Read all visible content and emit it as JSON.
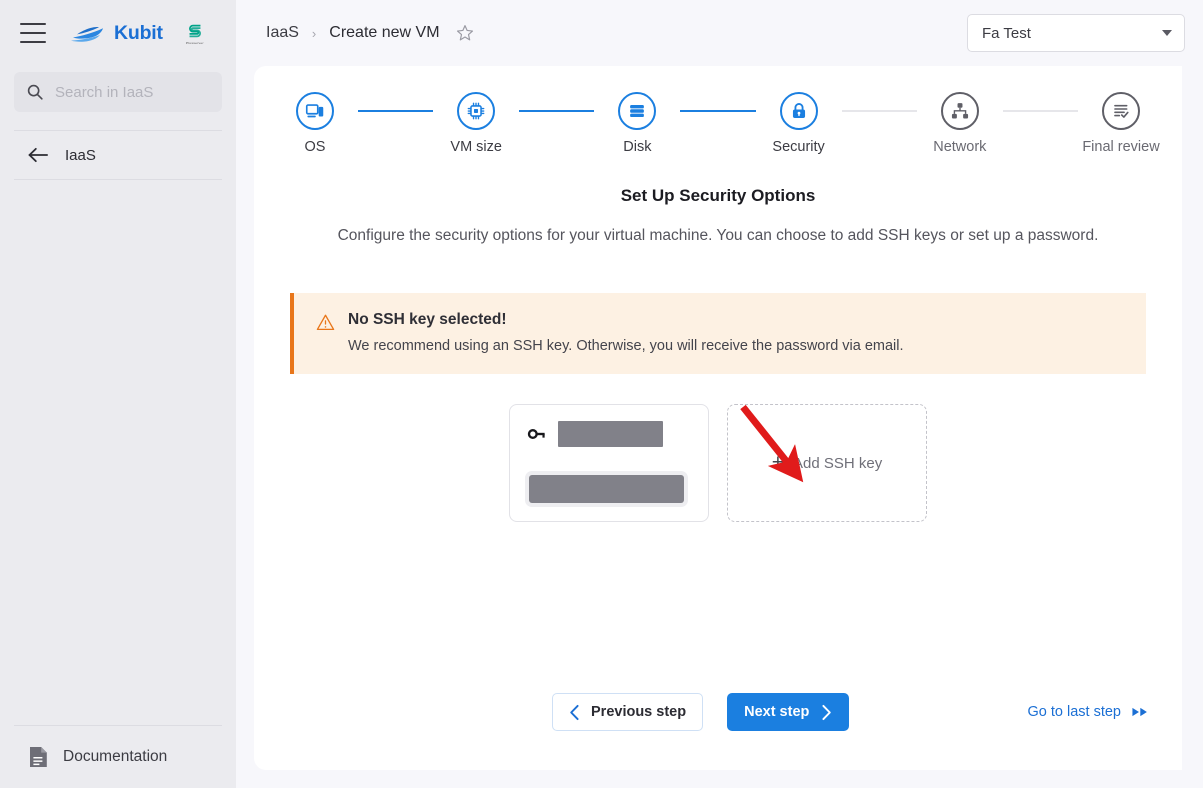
{
  "sidebar": {
    "menu_icon": "hamburger-menu-icon",
    "brand": {
      "name": "Kubit",
      "logo_icon": "kubit-boat-logo-icon"
    },
    "partner": {
      "logo_icon": "partner-s-logo-icon",
      "caption": "Plusserver"
    },
    "search": {
      "placeholder": "Search in IaaS",
      "value": "",
      "icon": "search-icon"
    },
    "back_nav": {
      "label": "IaaS",
      "icon": "arrow-left-icon"
    },
    "documentation": {
      "label": "Documentation",
      "icon": "document-icon"
    }
  },
  "topbar": {
    "breadcrumb": [
      {
        "label": "IaaS"
      },
      {
        "label": "Create new VM"
      }
    ],
    "breadcrumb_separator": "›",
    "favorite_icon": "star-outline-icon",
    "account": {
      "value": "Fa Test",
      "caret_icon": "chevron-down-icon"
    }
  },
  "stepper": {
    "steps": [
      {
        "label": "OS",
        "icon": "monitor-devices-icon",
        "state": "completed"
      },
      {
        "label": "VM size",
        "icon": "cpu-chip-icon",
        "state": "completed"
      },
      {
        "label": "Disk",
        "icon": "disk-stack-icon",
        "state": "completed"
      },
      {
        "label": "Security",
        "icon": "lock-icon",
        "state": "active"
      },
      {
        "label": "Network",
        "icon": "network-nodes-icon",
        "state": "upcoming"
      },
      {
        "label": "Final review",
        "icon": "checklist-icon",
        "state": "upcoming"
      }
    ],
    "active_color": "#1b7fe0",
    "inactive_color": "#5f5f67",
    "connector_dim_color": "#e6e6ea"
  },
  "main": {
    "title": "Set Up Security Options",
    "description": "Configure the security options for your virtual machine. You can choose to add SSH keys or set up a password.",
    "warning": {
      "icon": "warning-triangle-icon",
      "title": "No SSH key selected!",
      "text": "We recommend using an SSH key. Otherwise, you will receive the password via email.",
      "accent_color": "#e8761a",
      "background_color": "#fdf1e3"
    },
    "ssh_key_card": {
      "icon": "key-icon",
      "name_redacted": "",
      "fingerprint_redacted": "",
      "selected": false
    },
    "add_ssh_key": {
      "label": "Add SSH key",
      "plus_icon": "plus-icon"
    },
    "annotation": {
      "type": "red-arrow",
      "color": "#e01b1b",
      "points_to": "Add SSH key"
    }
  },
  "footer": {
    "previous": {
      "label": "Previous step",
      "icon": "chevron-left-icon"
    },
    "next": {
      "label": "Next step",
      "icon": "chevron-right-icon",
      "color": "#1b7fe0"
    },
    "last_step": {
      "label": "Go to last step",
      "icon": "fast-forward-icon",
      "color": "#1b6fd4"
    }
  }
}
